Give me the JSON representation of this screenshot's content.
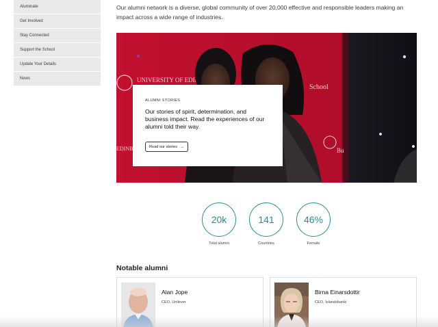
{
  "sidebar": {
    "items": [
      {
        "label": "Aluminate"
      },
      {
        "label": "Get Involved"
      },
      {
        "label": "Stay Connected"
      },
      {
        "label": "Support the School"
      },
      {
        "label": "Update Your Details"
      },
      {
        "label": "News"
      }
    ]
  },
  "intro": {
    "text": "Our alumni network is a diverse, global community of over 20,000 effective and responsible leaders making an impact across a wide range of industries."
  },
  "hero": {
    "banner_text_line1": "UNIVERSITY OF EDINBURGH",
    "banner_text_line2": "School",
    "banner_text_side": "EDINBURGH",
    "banner_text_right": "Bu"
  },
  "story": {
    "kicker": "ALUMNI STORIES",
    "text": "Our stories of spirit, determination, and business impact. Read the experiences of our alumni told their way.",
    "button_label": "Read our stories",
    "button_icon": "→"
  },
  "stats": [
    {
      "value": "20k",
      "label": "Total alumni"
    },
    {
      "value": "141",
      "label": "Countries"
    },
    {
      "value": "46%",
      "label": "Female"
    }
  ],
  "notable": {
    "title": "Notable alumni",
    "people": [
      {
        "name": "Alan Jope",
        "role": "CEO, Unilever"
      },
      {
        "name": "Birna Einarsdottir",
        "role": "CEO, Íslandsbanki"
      }
    ]
  },
  "colors": {
    "accent": "#2a8a9a",
    "hero_red": "#b5102c",
    "sidebar_bg": "#e9e9e9"
  }
}
